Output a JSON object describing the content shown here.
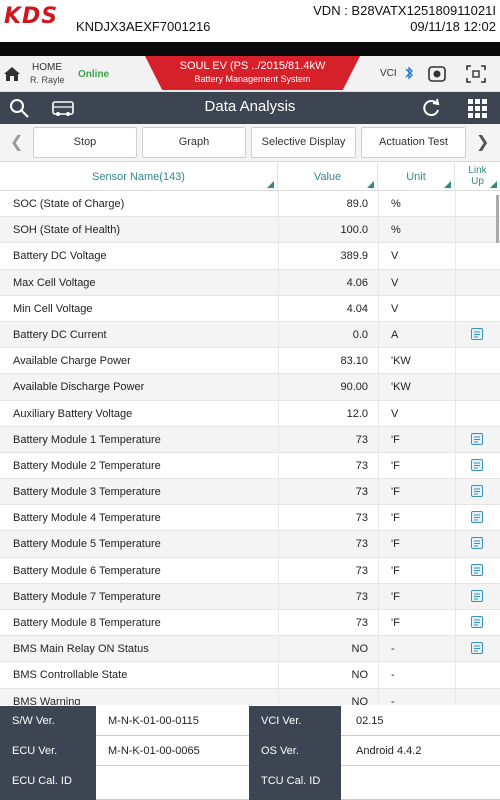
{
  "header": {
    "logo": "KDS",
    "vin": "KNDJX3AEXF7001216",
    "vdn": "VDN : B28VATX125180911021I",
    "date": "09/11/18 12:02"
  },
  "vehicle_bar": {
    "home_label": "HOME",
    "user": "R. Rayle",
    "status": "Online",
    "vehicle_line1": "SOUL EV (PS ../2015/81.4kW",
    "vehicle_line2": "Battery Management System",
    "vci_label": "VCI"
  },
  "title_bar": {
    "title": "Data Analysis"
  },
  "toolbar": {
    "buttons": [
      "Stop",
      "Graph",
      "Selective Display",
      "Actuation Test"
    ]
  },
  "table": {
    "columns": {
      "sensor": "Sensor Name(143)",
      "value": "Value",
      "unit": "Unit",
      "link1": "Link",
      "link2": "Up"
    },
    "rows": [
      {
        "name": "SOC (State of Charge)",
        "value": "89.0",
        "unit": "%",
        "link": false
      },
      {
        "name": "SOH (State of Health)",
        "value": "100.0",
        "unit": "%",
        "link": false
      },
      {
        "name": "Battery DC Voltage",
        "value": "389.9",
        "unit": "V",
        "link": false
      },
      {
        "name": "Max Cell Voltage",
        "value": "4.06",
        "unit": "V",
        "link": false
      },
      {
        "name": "Min Cell Voltage",
        "value": "4.04",
        "unit": "V",
        "link": false
      },
      {
        "name": "Battery DC Current",
        "value": "0.0",
        "unit": "A",
        "link": true
      },
      {
        "name": "Available Charge Power",
        "value": "83.10",
        "unit": "'KW",
        "link": false
      },
      {
        "name": "Available Discharge Power",
        "value": "90.00",
        "unit": "'KW",
        "link": false
      },
      {
        "name": "Auxiliary Battery Voltage",
        "value": "12.0",
        "unit": "V",
        "link": false
      },
      {
        "name": "Battery Module 1 Temperature",
        "value": "73",
        "unit": "'F",
        "link": true
      },
      {
        "name": "Battery Module 2 Temperature",
        "value": "73",
        "unit": "'F",
        "link": true
      },
      {
        "name": "Battery Module 3 Temperature",
        "value": "73",
        "unit": "'F",
        "link": true
      },
      {
        "name": "Battery Module 4 Temperature",
        "value": "73",
        "unit": "'F",
        "link": true
      },
      {
        "name": "Battery Module 5 Temperature",
        "value": "73",
        "unit": "'F",
        "link": true
      },
      {
        "name": "Battery Module 6 Temperature",
        "value": "73",
        "unit": "'F",
        "link": true
      },
      {
        "name": "Battery Module 7 Temperature",
        "value": "73",
        "unit": "'F",
        "link": true
      },
      {
        "name": "Battery Module 8 Temperature",
        "value": "73",
        "unit": "'F",
        "link": true
      },
      {
        "name": "BMS Main Relay ON Status",
        "value": "NO",
        "unit": "-",
        "link": true
      },
      {
        "name": "BMS Controllable State",
        "value": "NO",
        "unit": "-",
        "link": false
      },
      {
        "name": "BMS Warning",
        "value": "NO",
        "unit": "-",
        "link": false
      }
    ]
  },
  "footer": {
    "sw_label": "S/W Ver.",
    "sw_value": "M-N-K-01-00-0115",
    "vci_label": "VCI Ver.",
    "vci_value": "02.15",
    "ecu_label": "ECU Ver.",
    "ecu_value": "M-N-K-01-00-0065",
    "os_label": "OS Ver.",
    "os_value": "Android 4.4.2",
    "cal_label": "ECU Cal. ID",
    "cal_value": "",
    "tcu_label": "TCU Cal. ID",
    "tcu_value": ""
  },
  "colors": {
    "brand_red": "#d0161e",
    "title_bar": "#3d4552",
    "online_green": "#3aa24a",
    "header_teal": "#2d8a86",
    "link_icon": "#3a90c0"
  },
  "icons": [
    "home-icon",
    "bluetooth-icon",
    "record-icon",
    "screen-capture-icon",
    "search-icon",
    "car-icon",
    "refresh-icon",
    "grid-menu-icon",
    "chevron-left-icon",
    "chevron-right-icon",
    "link-up-icon"
  ]
}
